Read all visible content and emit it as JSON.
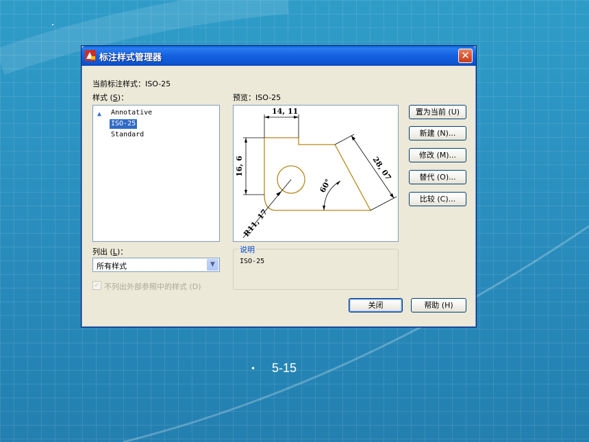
{
  "dialog": {
    "title": "标注样式管理器",
    "close_label": "✕",
    "current_style_label": "当前标注样式：ISO-25",
    "styles_label_prefix": "样式 (",
    "styles_label_key": "S",
    "styles_label_suffix": ")：",
    "styles": [
      "Annotative",
      "ISO-25",
      "Standard"
    ],
    "selected_style": "ISO-25",
    "preview_label": "预览：ISO-25",
    "list_label_prefix": "列出 (",
    "list_label_key": "L",
    "list_label_suffix": ")：",
    "list_combo_value": "所有样式",
    "xref_checkbox_label": "不列出外部参照中的样式 (D)",
    "description_title": "说明",
    "description_text": "ISO-25",
    "buttons": {
      "set_current": "置为当前 (U)",
      "new": "新建 (N)...",
      "modify": "修改 (M)...",
      "override": "替代 (O)...",
      "compare": "比较 (C)...",
      "close": "关闭",
      "help": "帮助 (H)"
    },
    "preview_dims": {
      "top": "14, 11",
      "left": "16, 6",
      "right": "28, 07",
      "angle": "60°",
      "radius": "R11, 17"
    }
  },
  "caption": {
    "bullet": "•",
    "text": "5-15"
  },
  "colors": {
    "background": "#2a8fbf",
    "titlebar": "#0a5fd8",
    "dialog": "#ece9d8",
    "selection": "#316ac5",
    "preview_lines": "#b5891a"
  }
}
